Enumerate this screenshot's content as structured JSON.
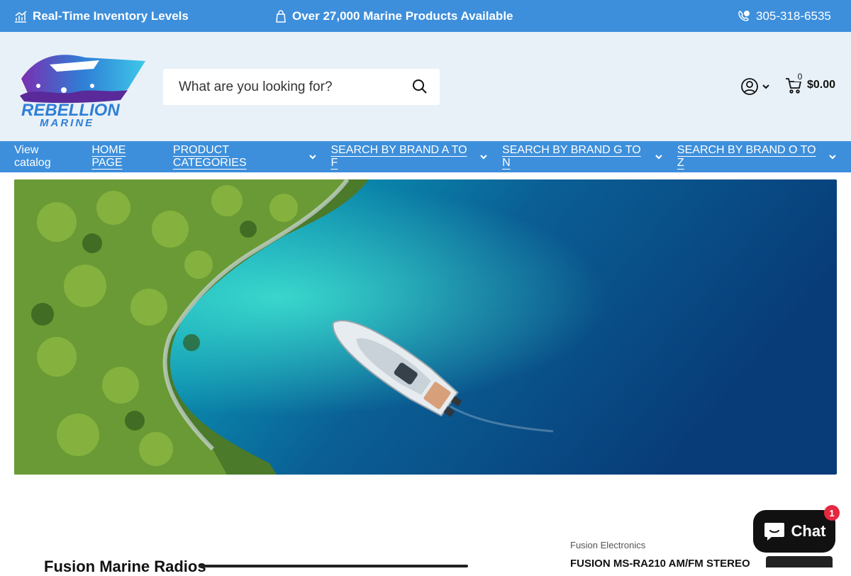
{
  "topbar": {
    "inventory": "Real-Time Inventory Levels",
    "products": "Over 27,000 Marine Products Available",
    "phone": "305-318-6535"
  },
  "logo": {
    "line1": "REBELLION",
    "line2": "MARINE"
  },
  "search": {
    "placeholder": "What are you looking for?"
  },
  "cart": {
    "count": "0",
    "total": "$0.00"
  },
  "nav": {
    "items": [
      {
        "label": "View catalog"
      },
      {
        "label": "HOME PAGE"
      },
      {
        "label": "PRODUCT CATEGORIES"
      },
      {
        "label": "SEARCH BY BRAND A TO F"
      },
      {
        "label": "SEARCH BY BRAND G TO N"
      },
      {
        "label": "SEARCH BY BRAND O TO Z"
      }
    ]
  },
  "section": {
    "title": "Fusion Marine Radios"
  },
  "product": {
    "brand": "Fusion Electronics",
    "name": "FUSION MS-RA210 AM/FM STEREO"
  },
  "chat": {
    "label": "Chat",
    "badge": "1"
  },
  "colors": {
    "accent": "#3d8fdb",
    "header_bg": "#e9f1f8",
    "chat_bg": "#111111",
    "badge": "#e5273f"
  }
}
